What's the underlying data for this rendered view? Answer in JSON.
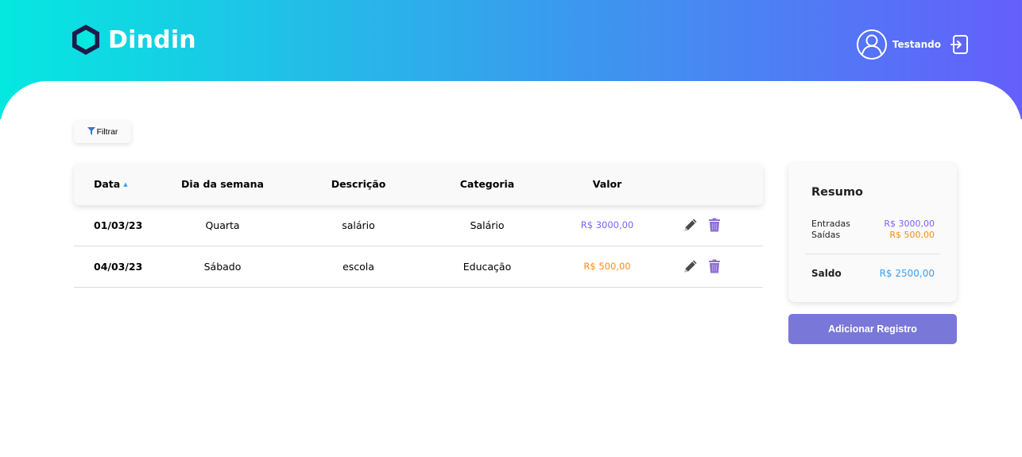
{
  "app": {
    "name": "Dindin"
  },
  "user": {
    "name": "Testando"
  },
  "filter": {
    "label": "Filtrar"
  },
  "table": {
    "columns": [
      "Data",
      "Dia da semana",
      "Descrição",
      "Categoria",
      "Valor"
    ],
    "rows": [
      {
        "date": "01/03/23",
        "weekday": "Quarta",
        "description": "salário",
        "category": "Salário",
        "value": "R$ 3000,00",
        "type": "entrada"
      },
      {
        "date": "04/03/23",
        "weekday": "Sábado",
        "description": "escola",
        "category": "Educação",
        "value": "R$ 500,00",
        "type": "saida"
      }
    ]
  },
  "summary": {
    "title": "Resumo",
    "entradas_label": "Entradas",
    "entradas_value": "R$ 3000,00",
    "saidas_label": "Saídas",
    "saidas_value": "R$ 500,00",
    "saldo_label": "Saldo",
    "saldo_value": "R$ 2500,00"
  },
  "add_button": {
    "label": "Adicionar Registro"
  },
  "colors": {
    "gradient_start": "#05E8E0",
    "gradient_end": "#645FFB",
    "income": "#7B61FF",
    "expense": "#FA8C10",
    "balance": "#3A9FF1",
    "primary_button": "#7978D9"
  },
  "icons": {
    "logo": "hexagon-logo-icon",
    "avatar": "user-avatar-icon",
    "logout": "logout-icon",
    "filter": "funnel-icon",
    "sort": "sort-up-icon",
    "edit": "pencil-icon",
    "delete": "trash-icon"
  }
}
